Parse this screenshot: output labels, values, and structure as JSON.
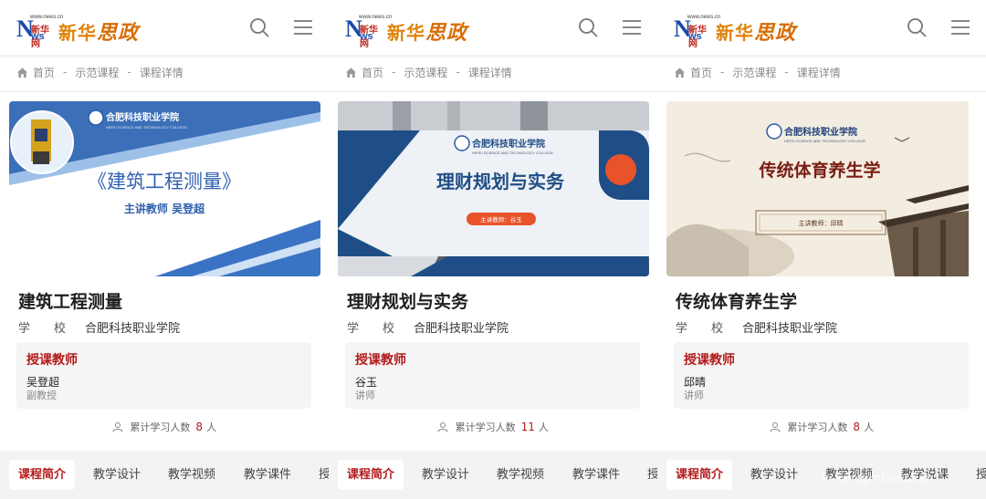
{
  "brand": {
    "site_small": "www.news.cn",
    "site_cn": "新华网",
    "news_ws": "ws",
    "news_n": "N",
    "brand_name": "新华",
    "brand_big": "思政"
  },
  "breadcrumb": [
    "首页",
    "示范课程",
    "课程详情"
  ],
  "school_label": "学　　校",
  "teacher_heading": "授课教师",
  "learners_label": "累计学习人数",
  "learners_unit": "人",
  "banner_college": "合肥科技职业学院",
  "banner_college_en": "HEFEI SCIENCE AND TECHNOLOGY COLLEGE",
  "panels": [
    {
      "title": "建筑工程测量",
      "school": "合肥科技职业学院",
      "teacher_name": "吴登超",
      "teacher_title": "副教授",
      "learners": "8",
      "banner_title": "《建筑工程测量》",
      "banner_sub": "主讲教师  吴登超",
      "tabs": [
        "课程简介",
        "教学设计",
        "教学视频",
        "教学课件",
        "授"
      ]
    },
    {
      "title": "理财规划与实务",
      "school": "合肥科技职业学院",
      "teacher_name": "谷玉",
      "teacher_title": "讲师",
      "learners": "11",
      "banner_title": "理财规划与实务",
      "banner_sub": "主讲教师：谷玉",
      "tabs": [
        "课程简介",
        "教学设计",
        "教学视频",
        "教学课件",
        "授"
      ]
    },
    {
      "title": "传统体育养生学",
      "school": "合肥科技职业学院",
      "teacher_name": "邱晴",
      "teacher_title": "讲师",
      "learners": "8",
      "banner_title": "传统体育养生学",
      "banner_sub": "主讲教师：邱晴",
      "tabs": [
        "课程简介",
        "教学设计",
        "教学视频",
        "教学说课",
        "授"
      ]
    }
  ],
  "watermark": "tr-vallegit*Loo1a.cn",
  "colors": {
    "accent_red": "#b31b1b",
    "brand_blue": "#1a4aa8",
    "brand_orange": "#e0830a"
  }
}
